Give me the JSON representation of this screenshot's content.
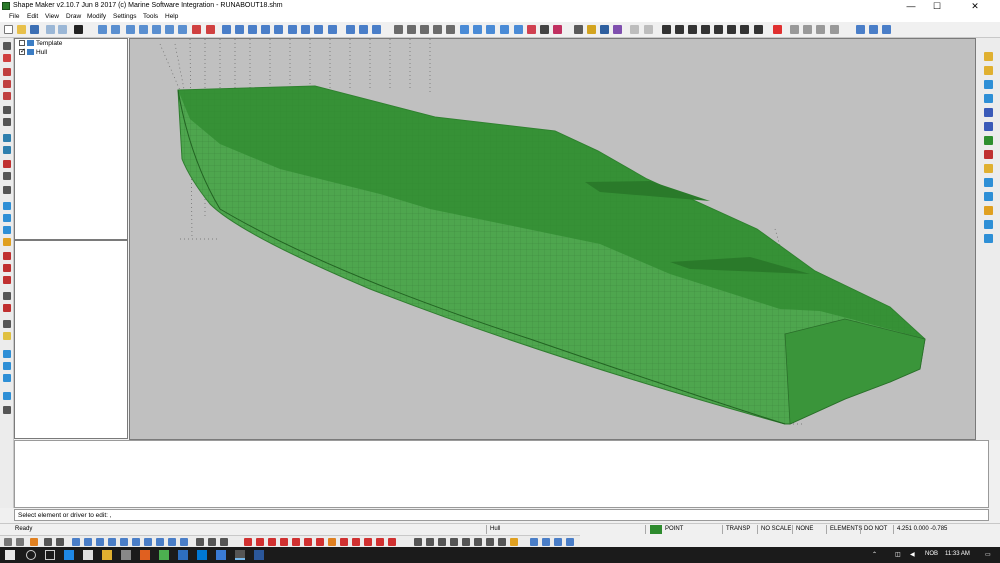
{
  "window": {
    "title": "Shape Maker v2.10.7 Jun  8 2017 (c) Marine Software Integration  - RUNABOUT18.shm",
    "minimize_glyph": "—",
    "maximize_glyph": "☐",
    "close_glyph": "✕"
  },
  "menu": [
    "File",
    "Edit",
    "View",
    "Draw",
    "Modify",
    "Settings",
    "Tools",
    "Help"
  ],
  "tree": {
    "items": [
      {
        "label": "Template",
        "checked": false
      },
      {
        "label": "Hull",
        "checked": true
      }
    ]
  },
  "prompt": {
    "text": "Select element or driver to edit: ,"
  },
  "status": {
    "ready": "Ready",
    "element": "Hull",
    "mode": "POINT",
    "transp": "TRANSP",
    "no_scale": "NO SCALE",
    "none": "NONE",
    "elements": "ELEMENTS",
    "do_not": "DO NOT",
    "coords": "4.251 0.000 -0.785"
  },
  "tray": {
    "lang": "NOB",
    "time": "11:33 AM"
  },
  "colors": {
    "hull_fill": "#4ea64e",
    "hull_dark": "#2f7d2f",
    "viewport_bg": "#c0c0c0",
    "status_green": "#2e8b2e",
    "taskbar": "#1b1b1b"
  },
  "icons": {
    "toolbar": [
      "new-icon",
      "open-icon",
      "save-icon",
      "undo-icon",
      "redo-icon",
      "help-icon",
      "zoom-in-icon",
      "zoom-out-icon",
      "zoom-window-icon",
      "pan-icon",
      "rotate-icon",
      "view-top-icon",
      "view-side-icon",
      "view-front-icon",
      "shade-icon",
      "grid-icon",
      "select-icon",
      "delete-icon"
    ],
    "left": [
      "line-icon",
      "curve-icon",
      "point-icon",
      "edit-icon",
      "surface-icon"
    ],
    "right": [
      "render-icon",
      "layers-icon",
      "color-icon"
    ]
  }
}
